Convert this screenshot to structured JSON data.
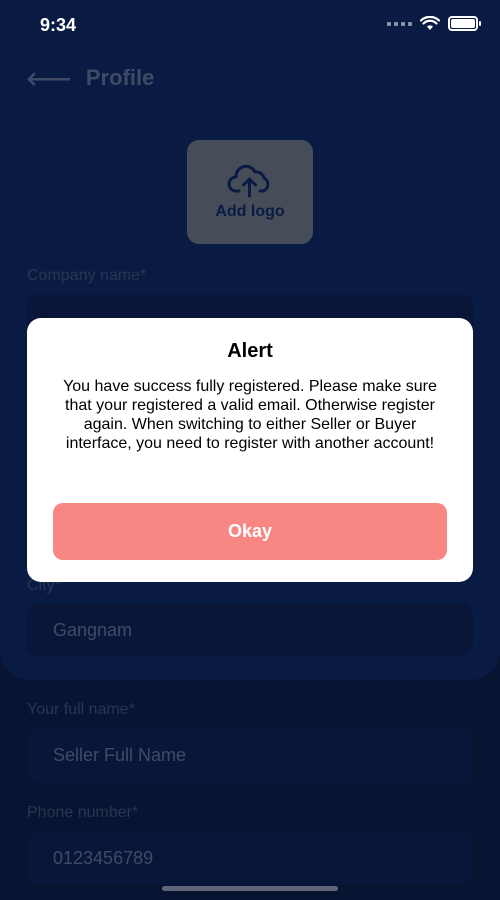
{
  "status_bar": {
    "time": "9:34"
  },
  "header": {
    "back_icon": "back-arrow-icon",
    "title": "Profile"
  },
  "logo_upload": {
    "icon": "cloud-upload-icon",
    "label": "Add logo"
  },
  "form": {
    "company_name": {
      "label": "Company name*",
      "value": ""
    },
    "city": {
      "label": "City*",
      "value": "Gangnam"
    },
    "full_name": {
      "label": "Your full name*",
      "value": "Seller Full Name"
    },
    "phone": {
      "label": "Phone number*",
      "value": "0123456789"
    }
  },
  "alert": {
    "title": "Alert",
    "message": "You have success fully registered. Please make sure that your registered a valid email. Otherwise register again. When switching to either Seller or Buyer interface, you need to register with another account!",
    "button_label": "Okay"
  },
  "colors": {
    "background": "#0a1a3c",
    "panel": "#0c2358",
    "button": "#f88683"
  }
}
